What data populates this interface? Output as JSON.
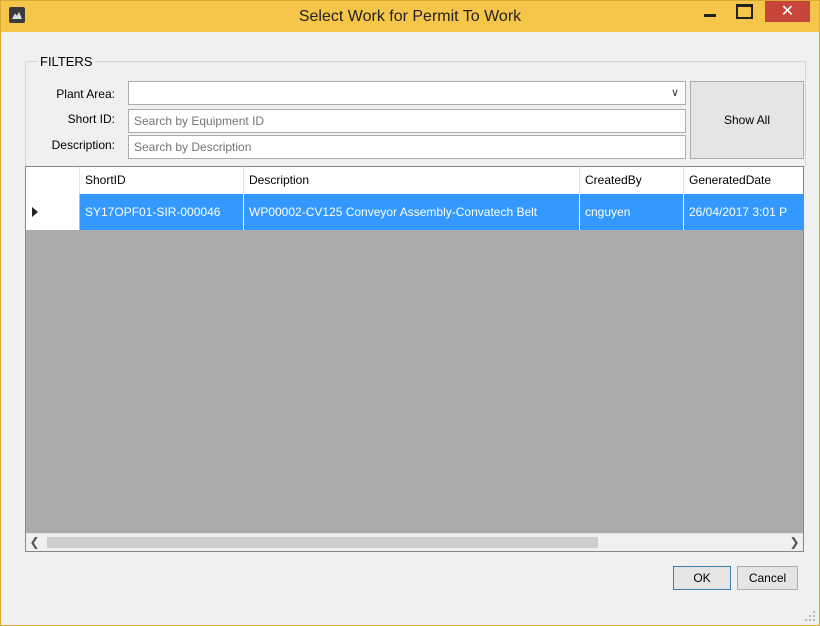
{
  "window": {
    "title": "Select Work for Permit To Work",
    "close_glyph": "✕"
  },
  "filters": {
    "group_label": "FILTERS",
    "plant_area_label": "Plant Area:",
    "plant_area_value": "",
    "short_id_label": "Short ID:",
    "short_id_placeholder": "Search by Equipment ID",
    "description_label": "Description:",
    "description_placeholder": "Search by Description",
    "show_all_label": "Show All"
  },
  "grid": {
    "columns": [
      "ShortID",
      "Description",
      "CreatedBy",
      "GeneratedDate"
    ],
    "rows": [
      {
        "short_id": "SY17OPF01-SIR-000046",
        "description": "WP00002-CV125 Conveyor Assembly-Convatech Belt",
        "created_by": "cnguyen",
        "generated_date": "26/04/2017 3:01 P"
      }
    ]
  },
  "footer": {
    "ok_label": "OK",
    "cancel_label": "Cancel"
  },
  "colors": {
    "titlebar": "#f6c64b",
    "selection": "#3399ff",
    "grid_background": "#ababab",
    "close_button": "#c7463c"
  }
}
